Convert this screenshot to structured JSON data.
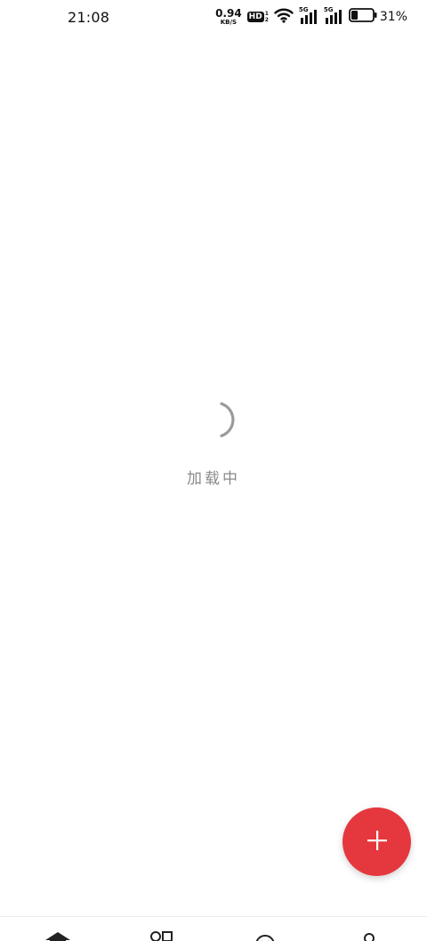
{
  "status_bar": {
    "time": "21:08",
    "net_speed_value": "0.94",
    "net_speed_unit": "KB/S",
    "hd_label": "HD",
    "hd_sup_top": "1",
    "hd_sup_bottom": "2",
    "sim1_label": "5G",
    "sim2_label": "5G",
    "battery_percent": "31%",
    "battery_level": 0.31,
    "icons": [
      "wifi-icon",
      "signal-icon",
      "battery-icon"
    ]
  },
  "loading": {
    "text": "加载中",
    "icon": "spinner-icon"
  },
  "fab": {
    "icon": "plus-icon",
    "color": "#e5383e"
  },
  "bottom_nav": {
    "items": [
      {
        "icon": "home-icon"
      },
      {
        "icon": "grid-icon"
      },
      {
        "icon": "smile-icon"
      },
      {
        "icon": "profile-icon"
      }
    ]
  }
}
